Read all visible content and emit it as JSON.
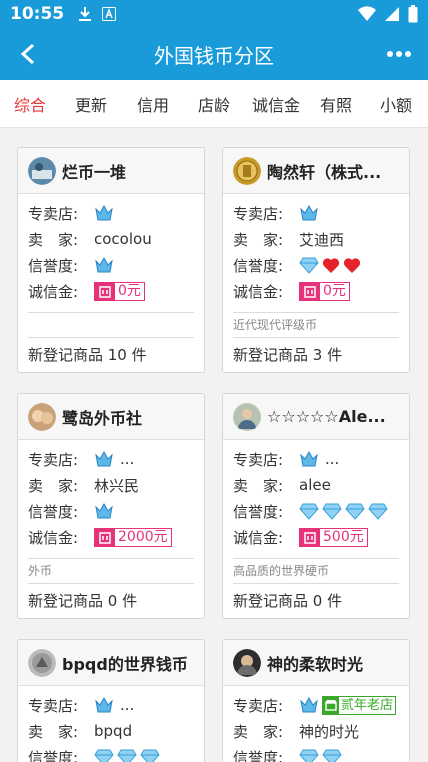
{
  "status_bar": {
    "time": "10:55"
  },
  "app_bar": {
    "title": "外国钱币分区"
  },
  "tabs": [
    "综合",
    "更新",
    "信用",
    "店龄",
    "诚信金",
    "有照",
    "小额"
  ],
  "labels": {
    "store": "专卖店:",
    "seller": "卖　家:",
    "credit": "信誉度:",
    "deposit": "诚信金:"
  },
  "cards": [
    {
      "name": "烂币一堆",
      "seller": "cocolou",
      "deposit": "0元",
      "desc": "",
      "footer": "新登记商品 10 件"
    },
    {
      "name": "陶然轩（株式...",
      "seller": "艾迪西",
      "deposit": "0元",
      "desc": "近代现代评级币",
      "footer": "新登记商品 3 件"
    },
    {
      "name": "鹭岛外币社",
      "store_more": "...",
      "seller": "林兴民",
      "deposit": "2000元",
      "desc": "外币",
      "footer": "新登记商品 0 件"
    },
    {
      "name": "☆☆☆☆☆Ale...",
      "store_more": "...",
      "seller": "alee",
      "deposit": "500元",
      "desc": "高品质的世界硬币",
      "footer": "新登记商品 0 件"
    },
    {
      "name": "bpqd的世界钱币",
      "store_more": "...",
      "seller": "bpqd"
    },
    {
      "name": "神的柔软时光",
      "store_badge": "贰年老店",
      "seller": "神的时光"
    }
  ],
  "colors": {
    "primary": "#1a9bd9",
    "active_tab": "#e63a3a",
    "deposit": "#e6327a",
    "old_shop": "#3aa829"
  }
}
